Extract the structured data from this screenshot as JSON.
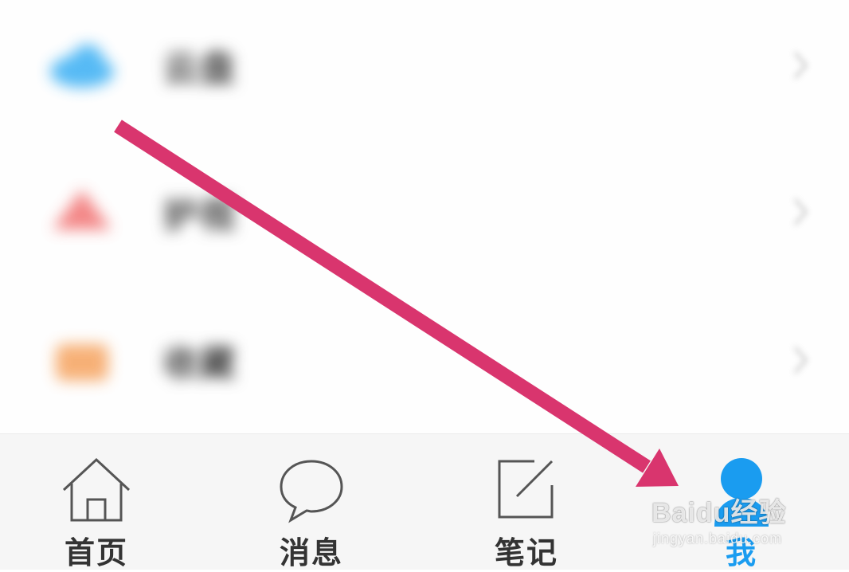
{
  "list": {
    "items": [
      {
        "icon": "cloud-icon",
        "color": "#44b3f4",
        "label": "云盘"
      },
      {
        "icon": "alert-icon",
        "color": "#f27a7a",
        "label": "护视"
      },
      {
        "icon": "folder-icon",
        "color": "#f6a868",
        "label": "收藏"
      }
    ]
  },
  "tabbar": {
    "tabs": [
      {
        "label": "首页",
        "icon": "home-icon"
      },
      {
        "label": "消息",
        "icon": "message-icon"
      },
      {
        "label": "笔记",
        "icon": "note-icon"
      },
      {
        "label": "我",
        "icon": "profile-icon",
        "active": true
      }
    ]
  },
  "colors": {
    "accent": "#1a9cf0",
    "arrow": "#d9356e",
    "tab_bg": "#f6f6f6"
  },
  "watermark": {
    "main": "Baidu经验",
    "sub": "jingyan.baidu.com"
  }
}
